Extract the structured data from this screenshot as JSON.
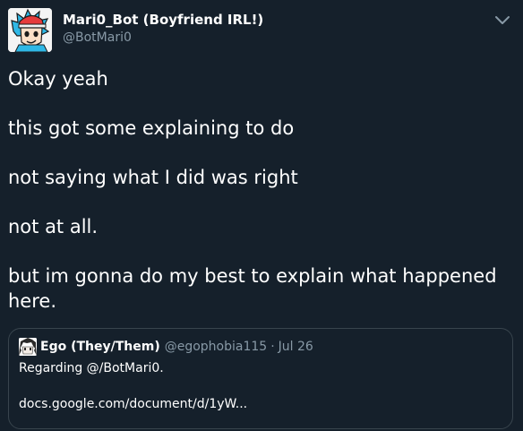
{
  "author": {
    "display_name": "Mari0_Bot (Boyfriend IRL!)",
    "handle": "@BotMari0",
    "avatar_icon": "boyfriend-character-avatar"
  },
  "menu": {
    "icon": "chevron-down-icon"
  },
  "tweet": {
    "paragraphs": [
      "Okay yeah",
      "this got some explaining to do",
      "not saying what I did was right",
      "not at all.",
      "but im gonna do my best to explain what happened here."
    ]
  },
  "quote": {
    "avatar_icon": "anime-character-avatar",
    "display_name": "Ego (They/Them)",
    "handle": "@egophobia115",
    "separator": "·",
    "date": "Jul 26",
    "text": "Regarding @/BotMari0.",
    "link": "docs.google.com/document/d/1yW..."
  },
  "colors": {
    "background": "#15202b",
    "text": "#ffffff",
    "secondary": "#8899a6",
    "border": "#38444d"
  }
}
